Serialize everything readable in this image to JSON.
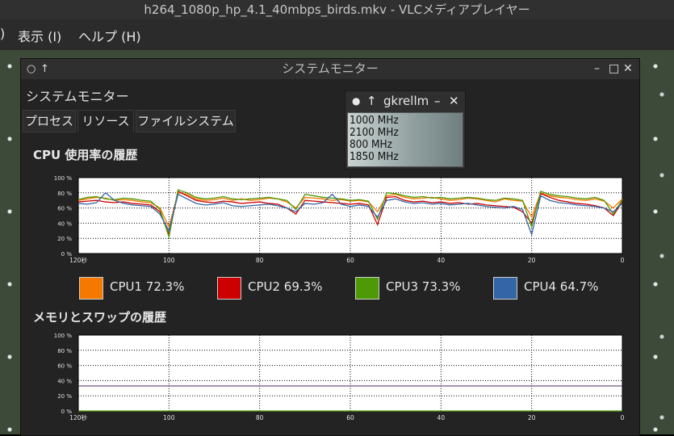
{
  "vlc": {
    "title": "h264_1080p_hp_4.1_40mbps_birds.mkv - VLCメディアプレイヤー",
    "menu_partial": ")",
    "menu_view": "表示 (I)",
    "menu_help": "ヘルプ (H)"
  },
  "system_monitor": {
    "window_title": "システムモニター",
    "heading": "システムモニター",
    "tabs": [
      "プロセス",
      "リソース",
      "ファイルシステム"
    ],
    "active_tab": "リソース",
    "cpu_section_title": "CPU 使用率の履歴",
    "mem_section_title": "メモリとスワップの履歴",
    "buttons": {
      "minimize": "–",
      "maximize": "□",
      "close": "✕"
    }
  },
  "gkrellm": {
    "title": "gkrellm",
    "freqs": [
      "1000 MHz",
      "2100 MHz",
      "800 MHz",
      "1850 MHz"
    ]
  },
  "chart_data": [
    {
      "type": "line",
      "title": "CPU 使用率の履歴",
      "x_ticks": [
        "120秒",
        "100",
        "80",
        "60",
        "40",
        "20",
        "0"
      ],
      "y_ticks": [
        "100 %",
        "80 %",
        "60 %",
        "40 %",
        "20 %",
        "0 %"
      ],
      "xlim": [
        120,
        0
      ],
      "ylim": [
        0,
        100
      ],
      "grid": true,
      "legend_position": "bottom",
      "x": [
        120,
        118,
        116,
        114,
        112,
        110,
        108,
        106,
        104,
        102,
        100,
        98,
        96,
        94,
        92,
        90,
        88,
        86,
        84,
        82,
        80,
        78,
        76,
        74,
        72,
        70,
        68,
        66,
        64,
        62,
        60,
        58,
        56,
        54,
        52,
        50,
        48,
        46,
        44,
        42,
        40,
        38,
        36,
        34,
        32,
        30,
        28,
        26,
        24,
        22,
        20,
        18,
        16,
        14,
        12,
        10,
        8,
        6,
        4,
        2,
        0
      ],
      "series": [
        {
          "name": "CPU1 72.3%",
          "color": "#f57900",
          "values": [
            70,
            72,
            74,
            73,
            70,
            71,
            70,
            68,
            67,
            60,
            35,
            80,
            78,
            72,
            70,
            71,
            73,
            70,
            72,
            70,
            71,
            73,
            72,
            68,
            60,
            74,
            73,
            72,
            70,
            71,
            69,
            70,
            68,
            55,
            76,
            78,
            74,
            72,
            73,
            74,
            72,
            70,
            71,
            73,
            72,
            70,
            68,
            72,
            70,
            69,
            48,
            80,
            76,
            74,
            73,
            71,
            70,
            72,
            69,
            60,
            72
          ]
        },
        {
          "name": "CPU2 69.3%",
          "color": "#cc0000",
          "values": [
            68,
            69,
            70,
            68,
            67,
            68,
            66,
            65,
            64,
            55,
            25,
            82,
            76,
            70,
            68,
            67,
            69,
            68,
            66,
            67,
            68,
            66,
            65,
            60,
            52,
            70,
            69,
            68,
            67,
            66,
            65,
            66,
            64,
            38,
            74,
            75,
            70,
            68,
            69,
            67,
            68,
            66,
            67,
            65,
            66,
            64,
            63,
            62,
            61,
            55,
            40,
            79,
            74,
            70,
            68,
            66,
            65,
            63,
            60,
            50,
            68
          ]
        },
        {
          "name": "CPU3 73.3%",
          "color": "#4e9a06",
          "values": [
            71,
            74,
            75,
            72,
            71,
            73,
            72,
            70,
            69,
            58,
            22,
            84,
            80,
            74,
            72,
            73,
            75,
            72,
            71,
            72,
            73,
            74,
            72,
            70,
            58,
            78,
            76,
            74,
            73,
            72,
            70,
            71,
            69,
            45,
            80,
            79,
            76,
            74,
            75,
            73,
            74,
            72,
            73,
            74,
            73,
            71,
            70,
            73,
            72,
            70,
            35,
            82,
            78,
            76,
            75,
            73,
            72,
            74,
            70,
            52,
            71
          ]
        },
        {
          "name": "CPU4 64.7%",
          "color": "#3465a4",
          "values": [
            66,
            65,
            67,
            80,
            70,
            66,
            64,
            63,
            62,
            52,
            30,
            78,
            72,
            66,
            64,
            65,
            67,
            63,
            62,
            63,
            64,
            65,
            63,
            60,
            55,
            66,
            65,
            67,
            78,
            65,
            62,
            64,
            62,
            48,
            70,
            72,
            68,
            66,
            67,
            65,
            66,
            64,
            65,
            66,
            64,
            62,
            61,
            60,
            62,
            58,
            25,
            76,
            70,
            67,
            66,
            64,
            63,
            62,
            60,
            55,
            66
          ]
        }
      ]
    },
    {
      "type": "line",
      "title": "メモリとスワップの履歴",
      "x_ticks": [
        "120秒",
        "100",
        "80",
        "60",
        "40",
        "20",
        "0"
      ],
      "y_ticks": [
        "100 %",
        "80 %",
        "60 %",
        "40 %",
        "20 %",
        "0 %"
      ],
      "xlim": [
        120,
        0
      ],
      "ylim": [
        0,
        100
      ],
      "grid": true,
      "series": [
        {
          "color": "#75507b",
          "values_constant": 33
        },
        {
          "color": "#4e9a06",
          "values_constant": 0
        }
      ]
    }
  ]
}
